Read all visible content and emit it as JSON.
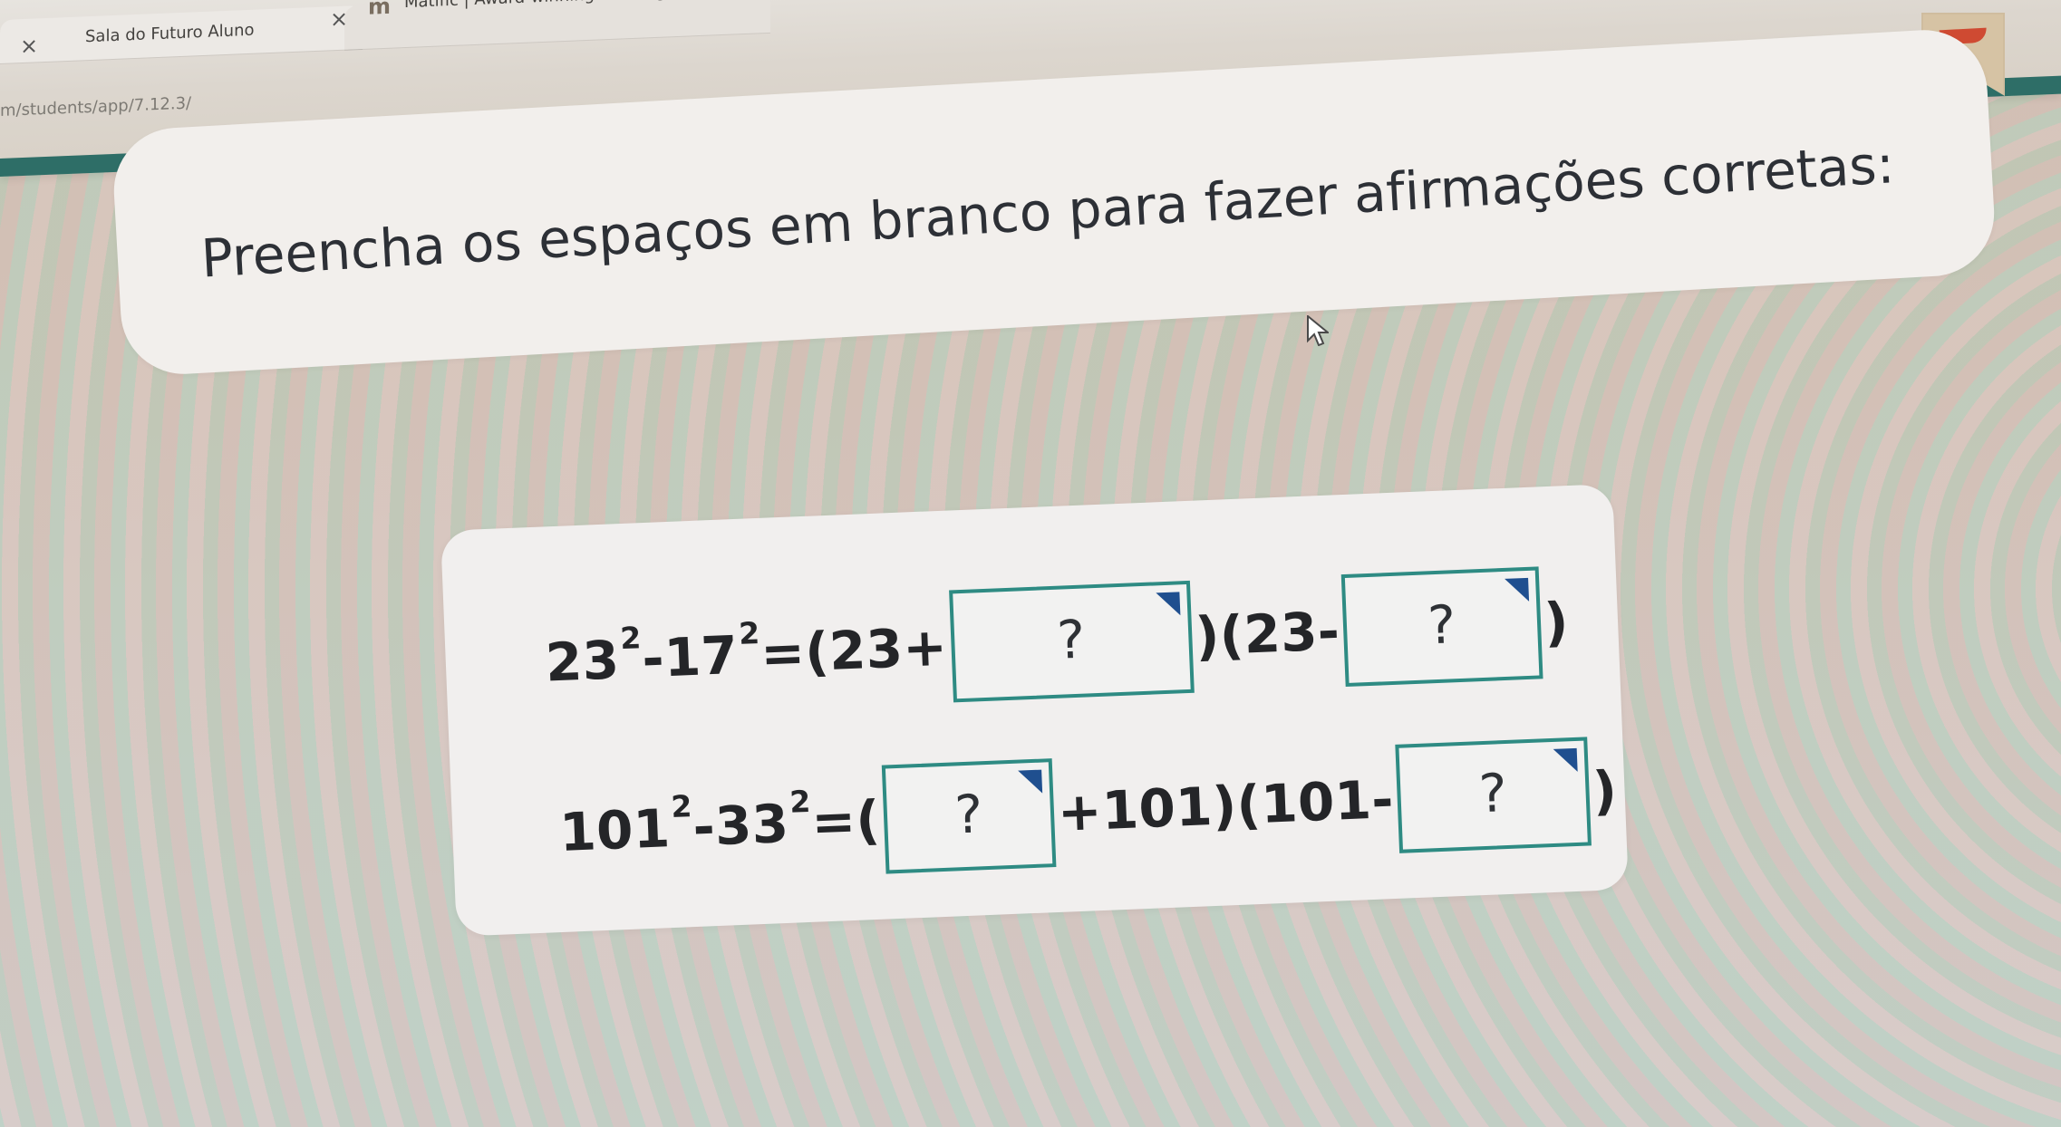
{
  "browser": {
    "tab1_title": "Sala do Futuro Aluno",
    "tab2_title": "Matific | Award-winning learning",
    "address": "m/students/app/7.12.3/"
  },
  "instruction": {
    "text": "Preencha os espaços em branco para fazer afirmações corretas:"
  },
  "equations": {
    "row1": {
      "left_base": "23",
      "left_power": "2",
      "minus": "-",
      "right_base": "17",
      "right_power": "2",
      "equals": "=",
      "open_1": "(",
      "factor_1_value": "23",
      "factor_1_operator": "+",
      "blank_1": "?",
      "close_1_open_2": ")(23-",
      "blank_2": "?",
      "close_2": ")"
    },
    "row2": {
      "left_base": "101",
      "left_power": "2",
      "minus": "-",
      "right_base": "33",
      "right_power": "2",
      "equals": "=",
      "open_1": "(",
      "blank_1": "?",
      "mid_text": "+101)(101-",
      "blank_2": "?",
      "close_2": ")"
    }
  }
}
